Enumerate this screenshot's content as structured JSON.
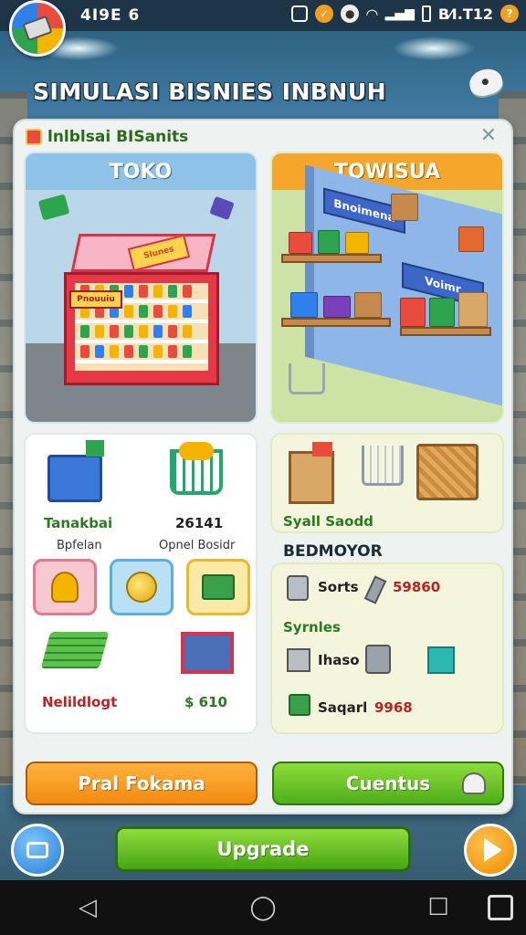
{
  "status_bar": {
    "clock": "4I9E 6",
    "right_text": "B⁄I.T12",
    "icons": [
      "app-logo-icon",
      "sim-icon",
      "alert-icon",
      "record-icon",
      "wifi-icon",
      "signal-icon",
      "battery-icon",
      "help-icon"
    ]
  },
  "header": {
    "title": "SIMULASI BISNIES INBNUH",
    "chat_icon": "chat-bubble-icon"
  },
  "panel": {
    "title": "lnlblsai BISanits",
    "close_glyph": "✕"
  },
  "cards": {
    "toko": {
      "title": "TOKO",
      "sign_text": "Slunes",
      "label_text": "Pnouuiu"
    },
    "warehouse": {
      "title": "TOWISUA",
      "banner_1": "Bnoimena",
      "banner_2": "Voimr"
    }
  },
  "info_left": {
    "item_1_label": "Tanakbai",
    "item_1_sub": "Bpfelan",
    "item_2_value": "26141",
    "item_2_sub": "Opnel Bosidr",
    "item_3_label": "Nelildlogt",
    "item_4_value": "$ 610"
  },
  "info_right_top": {
    "label": "Syall Saodd"
  },
  "section_title": "BEDMOYOR",
  "info_right_bottom": {
    "row_1_label": "Sorts",
    "row_1_value": "59860",
    "row_2_label": "Syrnles",
    "row_3_label": "Ihaso",
    "row_4_label": "Saqarl",
    "row_4_value": "9968"
  },
  "buttons": {
    "orange": "Pral Fokama",
    "green": "Cuentus",
    "upgrade": "Upgrade"
  },
  "navbar": {
    "back": "◁",
    "home": "◯",
    "recents": "☐"
  },
  "colors": {
    "accent_orange": "#f28a12",
    "accent_green": "#4fae1a",
    "value_red": "#c02020",
    "label_green": "#2a7a22"
  }
}
